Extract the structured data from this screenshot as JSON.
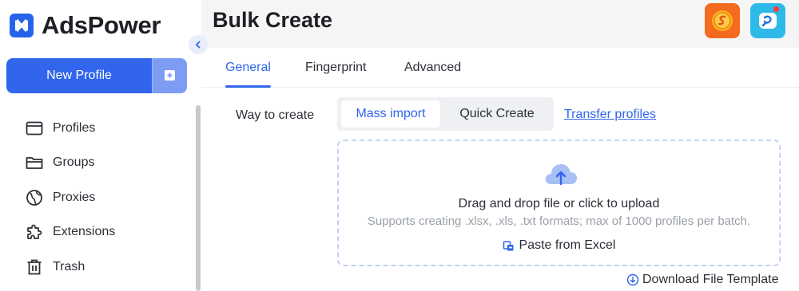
{
  "app": {
    "name": "AdsPower"
  },
  "sidebar": {
    "new_profile_label": "New Profile",
    "items": [
      {
        "label": "Profiles",
        "icon": "profiles-icon"
      },
      {
        "label": "Groups",
        "icon": "folder-icon"
      },
      {
        "label": "Proxies",
        "icon": "globe-icon"
      },
      {
        "label": "Extensions",
        "icon": "puzzle-icon"
      },
      {
        "label": "Trash",
        "icon": "trash-icon"
      }
    ]
  },
  "header": {
    "title": "Bulk Create"
  },
  "tabs": [
    {
      "label": "General",
      "active": true
    },
    {
      "label": "Fingerprint",
      "active": false
    },
    {
      "label": "Advanced",
      "active": false
    }
  ],
  "form": {
    "way_label": "Way to create",
    "options": [
      {
        "label": "Mass import",
        "selected": true
      },
      {
        "label": "Quick Create",
        "selected": false
      }
    ],
    "transfer_link": "Transfer profiles"
  },
  "dropzone": {
    "title": "Drag and drop file or click to upload",
    "subtitle": "Supports creating .xlsx, .xls, .txt formats; max of 1000 profiles per batch.",
    "paste_label": "Paste from Excel"
  },
  "download_label": "Download File Template",
  "colors": {
    "accent": "#3065ec",
    "accent_light": "#7d9cf3",
    "coin_bg": "#f46a1f",
    "help_bg": "#2ebae8"
  }
}
